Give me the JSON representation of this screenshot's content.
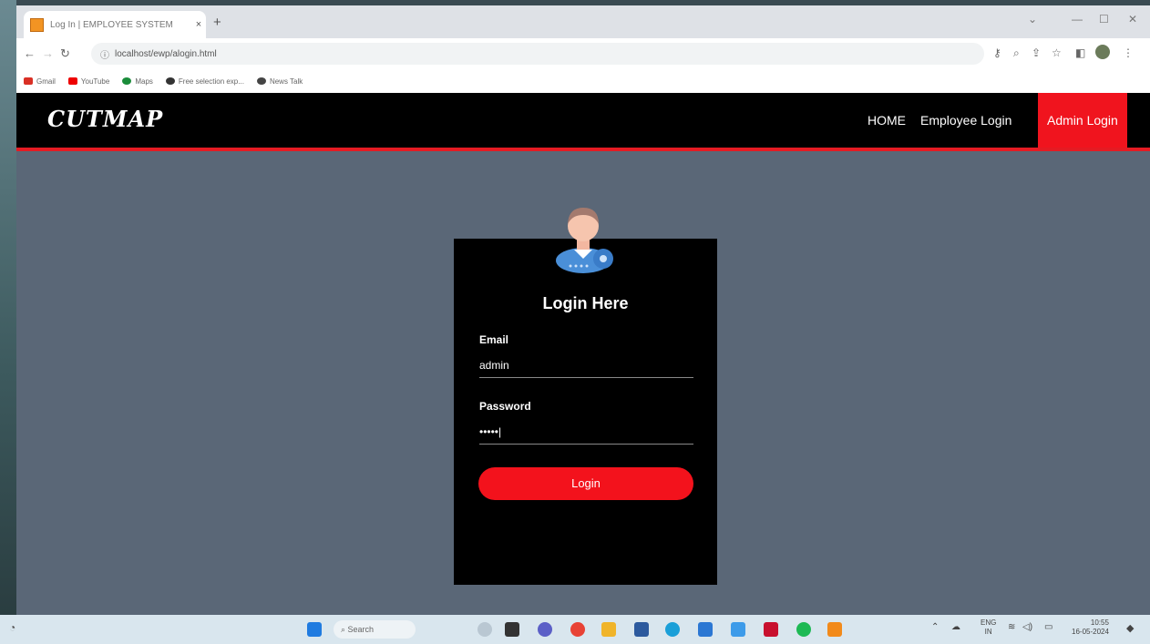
{
  "browser": {
    "tab_title": "Log In | EMPLOYEE SYSTEM",
    "tab_close": "×",
    "new_tab": "+",
    "url": "localhost/ewp/alogin.html",
    "bookmarks": [
      {
        "label": "Gmail",
        "color": "#d93025"
      },
      {
        "label": "YouTube",
        "color": "#e00"
      },
      {
        "label": "Maps",
        "color": "#1a8c3a"
      },
      {
        "label": "Free selection exp...",
        "color": "#333"
      },
      {
        "label": "News Talk",
        "color": "#444"
      }
    ]
  },
  "site": {
    "logo": "CUTMAP",
    "nav": {
      "home": "HOME",
      "employee_login": "Employee Login",
      "admin_login": "Admin Login"
    }
  },
  "login": {
    "title": "Login Here",
    "email_label": "Email",
    "email_value": "admin",
    "password_label": "Password",
    "password_value": "•••••|",
    "button_label": "Login"
  },
  "taskbar": {
    "search_placeholder": "Search",
    "lang_top": "ENG",
    "lang_bottom": "IN",
    "time": "10:55",
    "date": "16-05-2024"
  }
}
